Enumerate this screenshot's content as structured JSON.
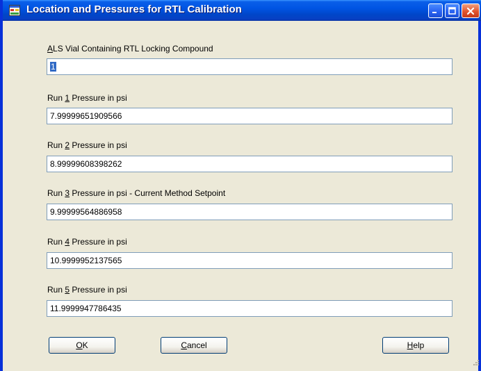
{
  "window": {
    "title": "Location and Pressures for RTL Calibration"
  },
  "fields": [
    {
      "label_mnemonic": "A",
      "label_rest": "LS Vial Containing RTL Locking Compound",
      "value_selected": "1",
      "value": ""
    },
    {
      "label_prefix": "Run ",
      "label_mnemonic": "1",
      "label_rest": " Pressure in psi",
      "value": "7.99999651909566"
    },
    {
      "label_prefix": "Run ",
      "label_mnemonic": "2",
      "label_rest": " Pressure in psi",
      "value": "8.99999608398262"
    },
    {
      "label_prefix": "Run ",
      "label_mnemonic": "3",
      "label_rest": " Pressure in psi - Current Method Setpoint",
      "value": "9.99999564886958"
    },
    {
      "label_prefix": "Run ",
      "label_mnemonic": "4",
      "label_rest": " Pressure in psi",
      "value": "10.9999952137565"
    },
    {
      "label_prefix": "Run ",
      "label_mnemonic": "5",
      "label_rest": " Pressure in psi",
      "value": "11.9999947786435"
    }
  ],
  "buttons": {
    "ok_mnemonic": "O",
    "ok_rest": "K",
    "cancel_mnemonic": "C",
    "cancel_rest": "ancel",
    "help_mnemonic": "H",
    "help_rest": "elp"
  },
  "icons": {
    "app": "app-window-icon",
    "minimize": "minimize-icon",
    "maximize": "maximize-icon",
    "close": "close-icon",
    "resize": "resize-grip-icon"
  },
  "colors": {
    "titlebar": "#0054e3",
    "window_bg": "#ece9d8",
    "selection": "#316ac5",
    "input_border": "#7f9db9"
  }
}
